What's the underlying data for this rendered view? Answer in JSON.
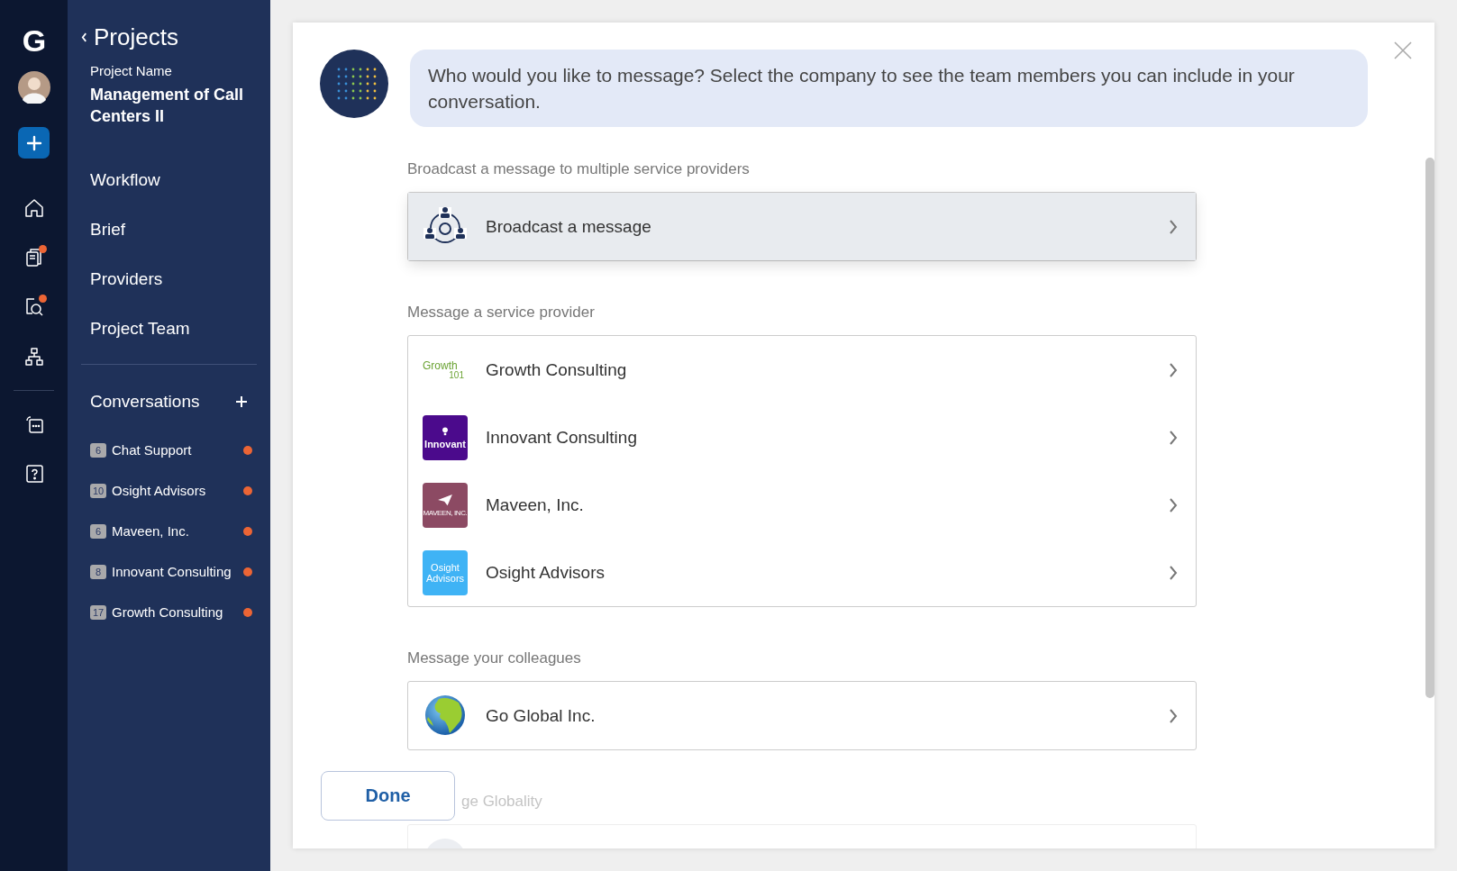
{
  "rail": {
    "logo": "G",
    "items_top": [
      {
        "kind": "home",
        "badge": false
      },
      {
        "kind": "documents",
        "badge": true
      },
      {
        "kind": "search",
        "badge": true
      },
      {
        "kind": "sitemap",
        "badge": false
      }
    ],
    "items_bottom": [
      {
        "kind": "chat",
        "badge": false
      },
      {
        "kind": "help",
        "badge": false
      }
    ]
  },
  "sidebar": {
    "back": "Projects",
    "project_label": "Project Name",
    "project_name": "Management of Call Centers II",
    "nav": [
      "Workflow",
      "Brief",
      "Providers",
      "Project Team"
    ],
    "conversations_title": "Conversations",
    "conversations": [
      {
        "count": "6",
        "name": "Chat Support",
        "unread": true
      },
      {
        "count": "10",
        "name": "Osight Advisors",
        "unread": true
      },
      {
        "count": "6",
        "name": "Maveen, Inc.",
        "unread": true
      },
      {
        "count": "8",
        "name": "Innovant Consulting",
        "unread": true
      },
      {
        "count": "17",
        "name": "Growth Consulting",
        "unread": true
      }
    ]
  },
  "dialog": {
    "prompt": "Who would you like to message? Select the company to see the team members you can include in your conversation.",
    "sections": [
      {
        "title": "Broadcast a message to multiple service providers",
        "rows": [
          {
            "kind": "broadcast",
            "label": "Broadcast a message",
            "highlighted": true
          }
        ]
      },
      {
        "title": "Message a service provider",
        "rows": [
          {
            "kind": "logo",
            "label": "Growth Consulting",
            "highlighted": false,
            "logo": {
              "kind": "wordmark",
              "color": "#ffffff",
              "text": [
                "Growth",
                "101"
              ]
            }
          },
          {
            "kind": "logo",
            "label": "Innovant Consulting",
            "highlighted": false,
            "logo": {
              "kind": "bulb",
              "color": "#4b0a8c",
              "text": [
                "Innovant"
              ]
            }
          },
          {
            "kind": "logo",
            "label": "Maveen, Inc.",
            "highlighted": false,
            "logo": {
              "kind": "plane",
              "color": "#8c4a63",
              "text": [
                "MAVEEN, INC."
              ]
            }
          },
          {
            "kind": "logo",
            "label": "Osight Advisors",
            "highlighted": false,
            "logo": {
              "kind": "plain",
              "color": "#3fb3f5",
              "text": [
                "Osight",
                "Advisors"
              ]
            }
          }
        ]
      },
      {
        "title": "Message your colleagues",
        "rows": [
          {
            "kind": "globe",
            "label": "Go Global Inc.",
            "highlighted": false
          }
        ]
      },
      {
        "title": "ge Globality",
        "rows": [
          {
            "kind": "blank"
          }
        ]
      }
    ],
    "done": "Done"
  }
}
